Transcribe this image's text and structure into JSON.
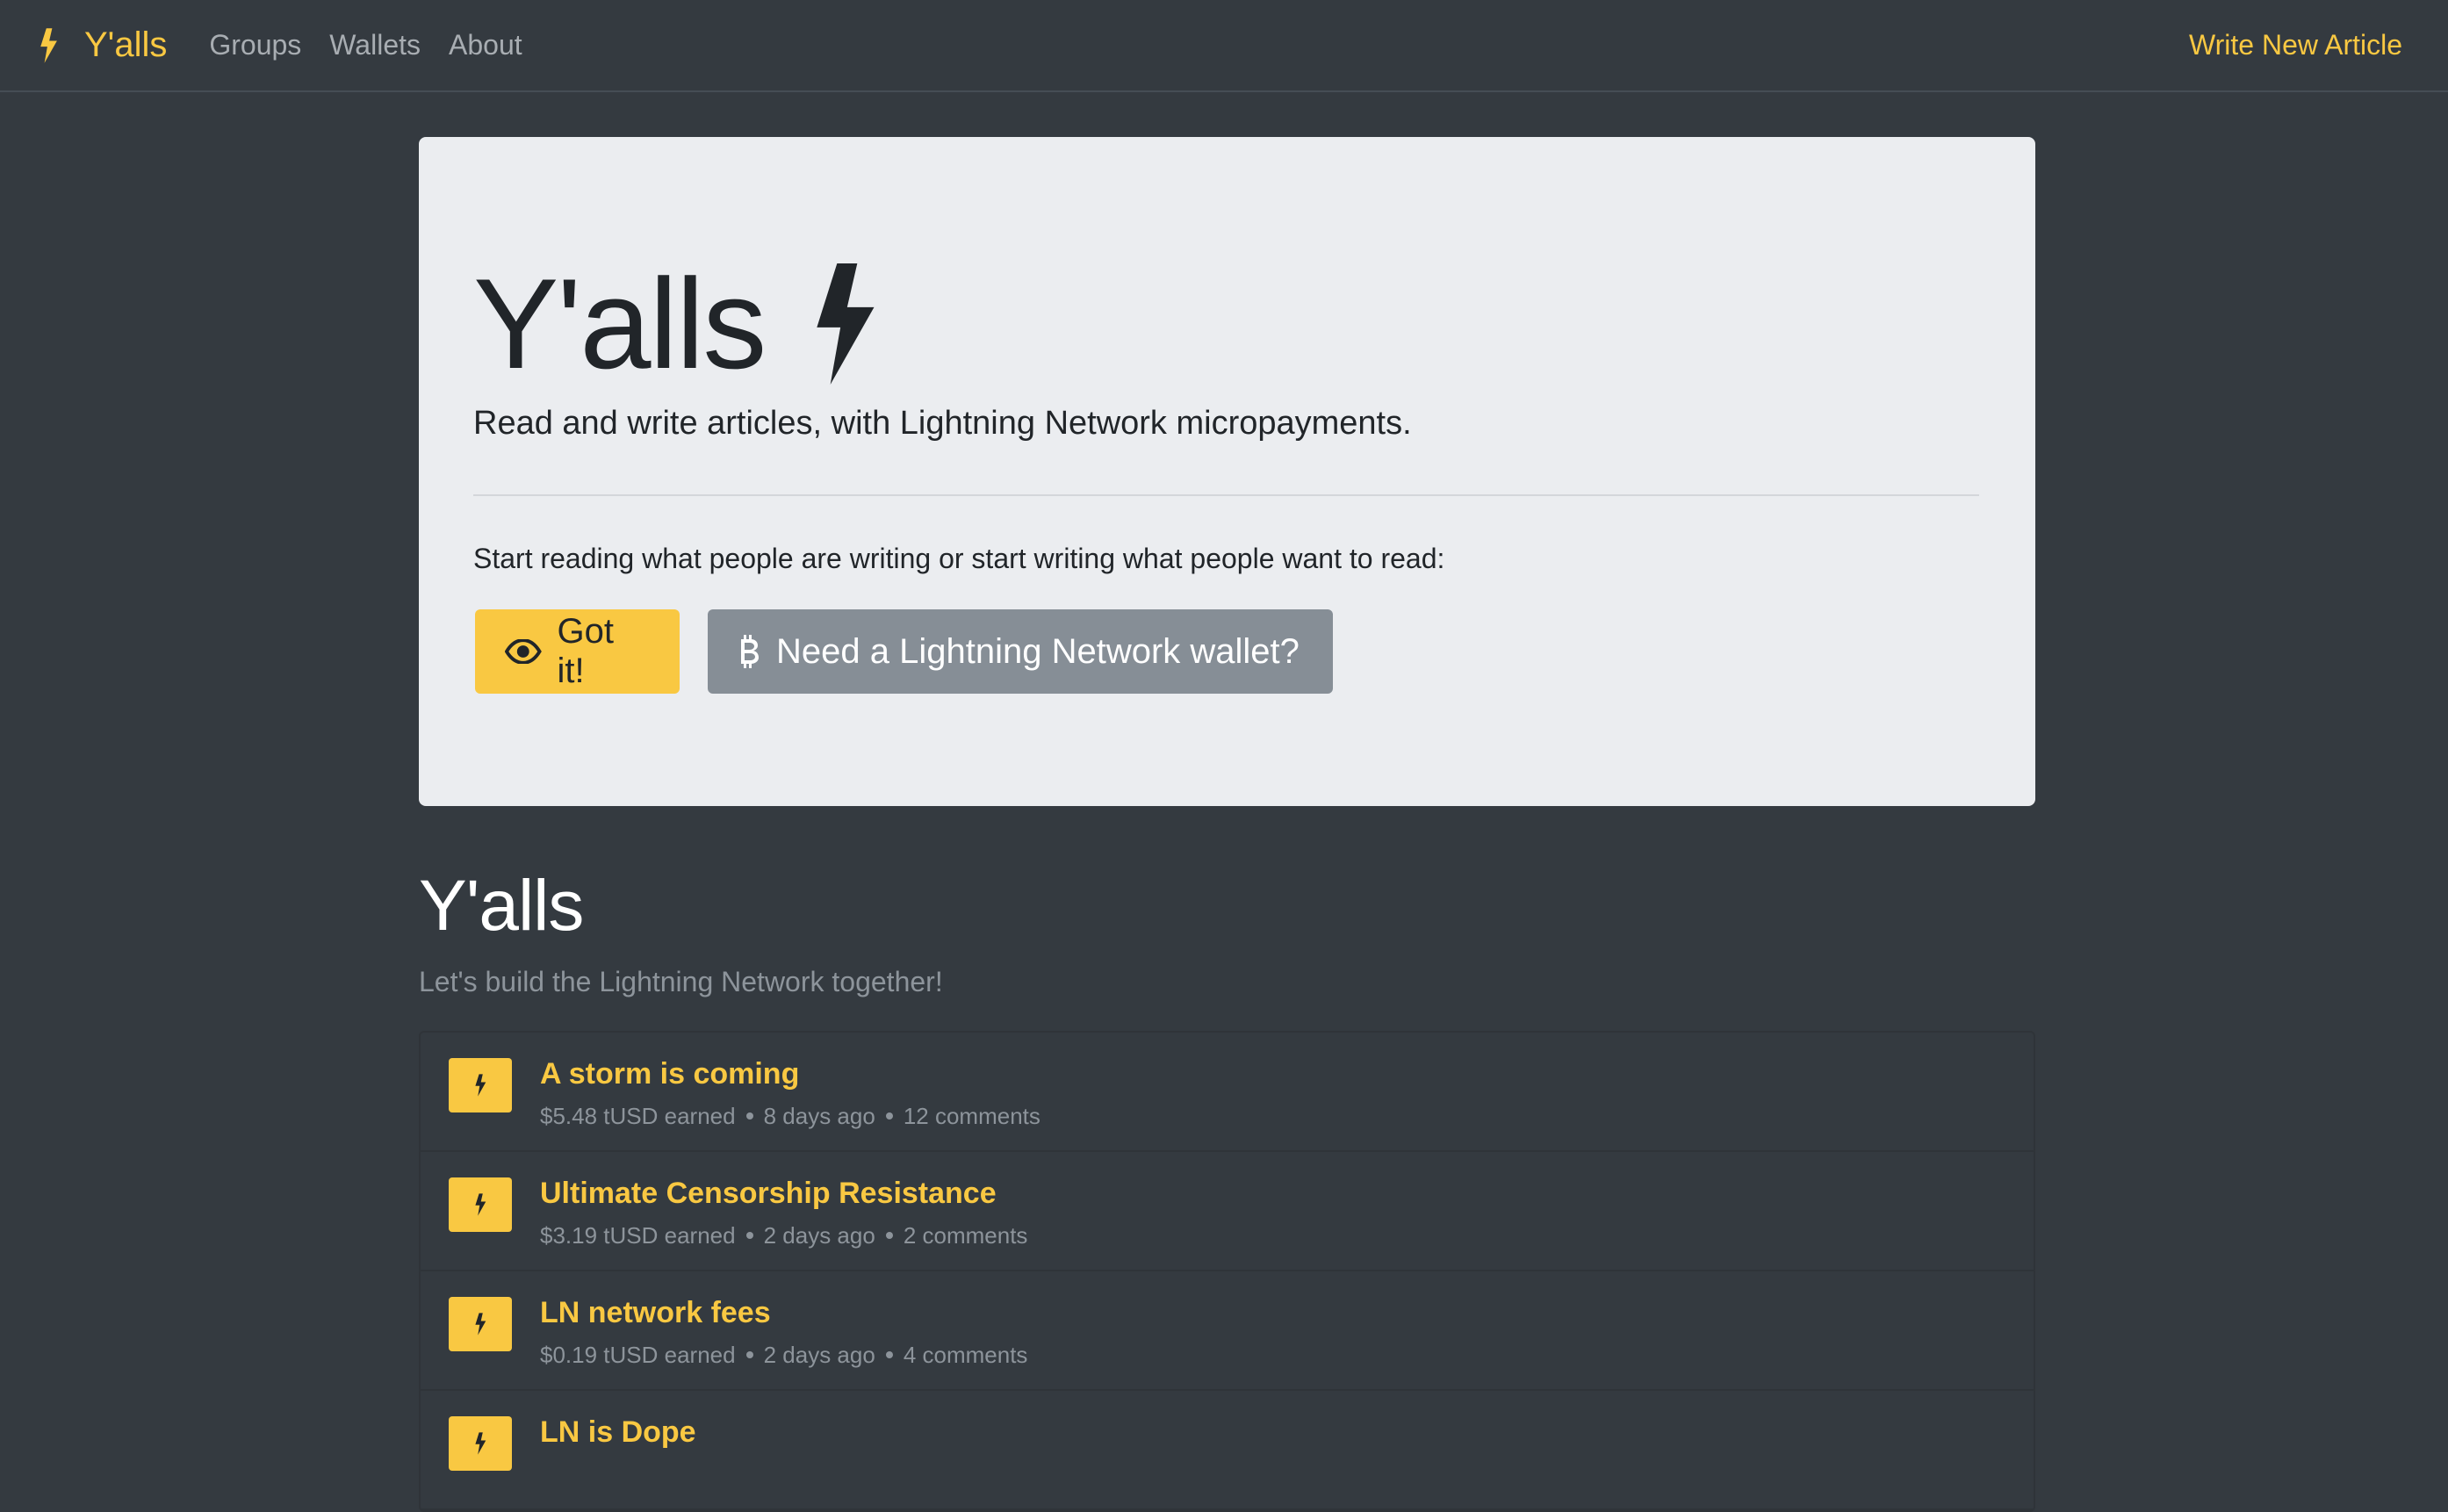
{
  "nav": {
    "brand": "Y'alls",
    "links": [
      "Groups",
      "Wallets",
      "About"
    ],
    "write": "Write New Article"
  },
  "hero": {
    "title": "Y'alls",
    "lead": "Read and write articles, with Lightning Network micropayments.",
    "text": "Start reading what people are writing or start writing what people want to read:",
    "primary_button": "Got it!",
    "secondary_button": "Need a Lightning Network wallet?"
  },
  "section": {
    "title": "Y'alls",
    "subtitle": "Let's build the Lightning Network together!"
  },
  "articles": [
    {
      "title": "A storm is coming",
      "earned": "$5.48 tUSD earned",
      "age": "8 days ago",
      "comments": "12 comments"
    },
    {
      "title": "Ultimate Censorship Resistance",
      "earned": "$3.19 tUSD earned",
      "age": "2 days ago",
      "comments": "2 comments"
    },
    {
      "title": "LN network fees",
      "earned": "$0.19 tUSD earned",
      "age": "2 days ago",
      "comments": "4 comments"
    },
    {
      "title": "LN is Dope",
      "earned": "",
      "age": "",
      "comments": ""
    }
  ],
  "colors": {
    "accent": "#f9c842",
    "background": "#343a40",
    "jumbotron": "#ebedf0",
    "secondary": "#868e96",
    "muted": "#8d949b"
  },
  "icons": {
    "brand": "bolt-icon",
    "primary_button": "eye-icon",
    "secondary_button": "bitcoin-icon",
    "article": "bolt-icon"
  }
}
